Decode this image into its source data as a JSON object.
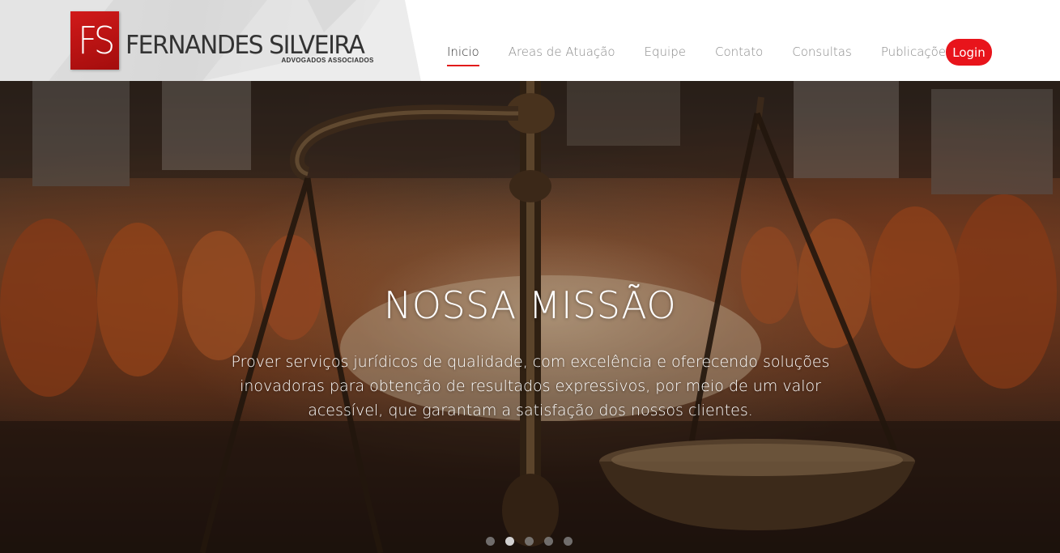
{
  "brand": {
    "mark": "FS",
    "name": "FERNANDES SILVEIRA",
    "subtitle": "ADVOGADOS ASSOCIADOS",
    "accent_color": "#e8141b"
  },
  "nav": {
    "items": [
      {
        "label": "Inicio",
        "active": true
      },
      {
        "label": "Areas de Atuação",
        "active": false
      },
      {
        "label": "Equipe",
        "active": false
      },
      {
        "label": "Contato",
        "active": false
      },
      {
        "label": "Consultas",
        "active": false
      },
      {
        "label": "Publicações",
        "active": false
      }
    ],
    "login_label": "Login"
  },
  "hero": {
    "title": "NOSSA MISSÃO",
    "text": "Prover serviços jurídicos de qualidade, com excelência e oferecendo soluções inovadoras para obtenção de resultados expressivos, por meio de um valor acessível, que garantam a satisfação dos nossos clientes.",
    "background_image": "scales-of-justice-photo",
    "slides_count": 5,
    "active_slide": 2
  }
}
